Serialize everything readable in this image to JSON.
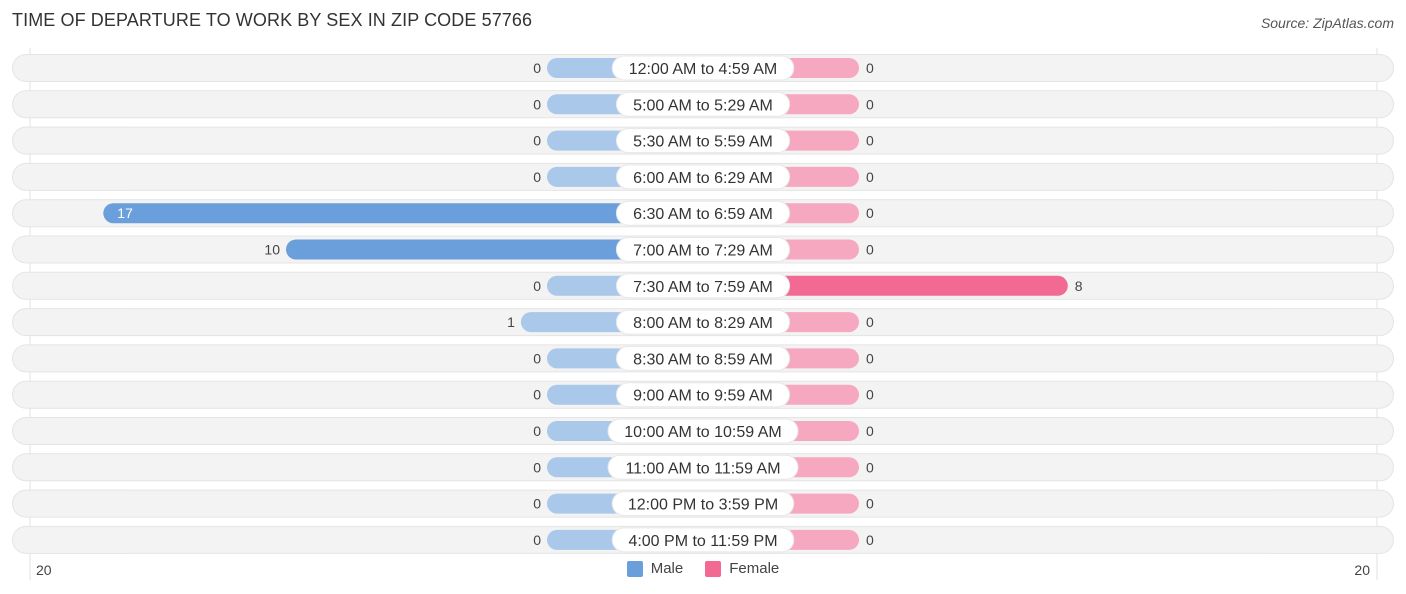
{
  "header": {
    "title": "TIME OF DEPARTURE TO WORK BY SEX IN ZIP CODE 57766",
    "source": "Source: ZipAtlas.com"
  },
  "colors": {
    "male_strong": "#6a9fdc",
    "male_light": "#a9c8ea",
    "female_strong": "#f26a94",
    "female_light": "#f6a8c0",
    "row_bg": "#f3f3f3"
  },
  "legend": {
    "male_label": "Male",
    "female_label": "Female"
  },
  "axis": {
    "left_label": "20",
    "right_label": "20"
  },
  "chart_data": {
    "type": "bar",
    "orientation": "horizontal-diverging",
    "title": "TIME OF DEPARTURE TO WORK BY SEX IN ZIP CODE 57766",
    "categories": [
      "12:00 AM to 4:59 AM",
      "5:00 AM to 5:29 AM",
      "5:30 AM to 5:59 AM",
      "6:00 AM to 6:29 AM",
      "6:30 AM to 6:59 AM",
      "7:00 AM to 7:29 AM",
      "7:30 AM to 7:59 AM",
      "8:00 AM to 8:29 AM",
      "8:30 AM to 8:59 AM",
      "9:00 AM to 9:59 AM",
      "10:00 AM to 10:59 AM",
      "11:00 AM to 11:59 AM",
      "12:00 PM to 3:59 PM",
      "4:00 PM to 11:59 PM"
    ],
    "series": [
      {
        "name": "Male",
        "values": [
          0,
          0,
          0,
          0,
          17,
          10,
          0,
          1,
          0,
          0,
          0,
          0,
          0,
          0
        ]
      },
      {
        "name": "Female",
        "values": [
          0,
          0,
          0,
          0,
          0,
          0,
          8,
          0,
          0,
          0,
          0,
          0,
          0,
          0
        ]
      }
    ],
    "xlim": [
      -20,
      20
    ],
    "axis_tick_labels": [
      "20",
      "20"
    ],
    "legend_placement": "bottom-center",
    "grid": false
  }
}
